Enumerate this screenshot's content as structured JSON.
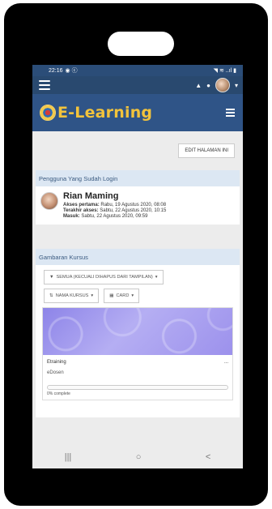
{
  "status_bar": {
    "time": "22:16",
    "signal_icons": "◥ ≋ ..ıl ▮"
  },
  "site": {
    "brand_name": "E-Learning"
  },
  "content": {
    "edit_button": "EDIT HALAMAN INI"
  },
  "logged_in": {
    "header": "Pengguna Yang Sudah Login",
    "name": "Rian Maming",
    "first_access_label": "Akses pertama:",
    "first_access": "Rabu, 19 Agustus 2020, 08:08",
    "last_access_label": "Terakhir akses:",
    "last_access": "Sabtu, 22 Agustus 2020, 10:15",
    "login_label": "Masuk:",
    "login": "Sabtu, 22 Agustus 2020, 09:59"
  },
  "course_overview": {
    "header": "Gambaran Kursus",
    "filter_label": "SEMUA (KECUALI DIHAPUS DARI TAMPILAN)",
    "sort_label": "NAMA KURSUS",
    "view_label": "CARD",
    "course": {
      "category": "Etraining",
      "name": "eDosen",
      "more": "...",
      "progress_percent": 0,
      "progress_text": "0% complete"
    }
  },
  "colors": {
    "brand_yellow": "#f2c33c",
    "header_blue": "#2f5487",
    "nav_blue": "#29496f"
  },
  "nav_buttons": {
    "recents": "|||",
    "home": "○",
    "back": "<"
  }
}
